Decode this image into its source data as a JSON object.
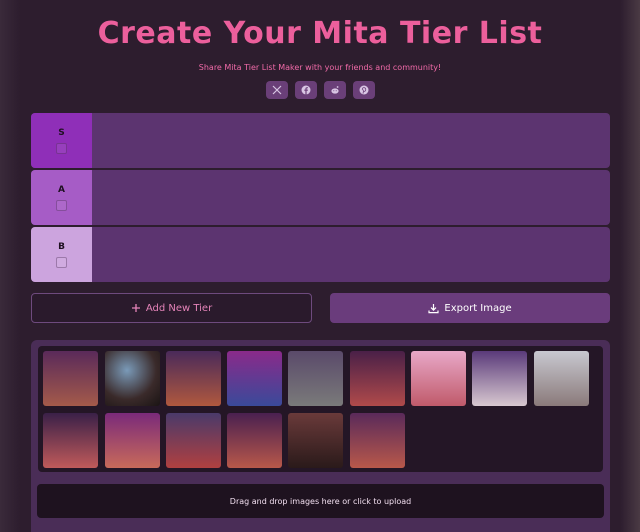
{
  "header": {
    "title": "Create Your Mita Tier List",
    "subtitle": "Share Mita Tier List Maker with your friends and community!"
  },
  "share": [
    {
      "name": "x-icon"
    },
    {
      "name": "facebook-icon"
    },
    {
      "name": "reddit-icon"
    },
    {
      "name": "pinterest-icon"
    }
  ],
  "tiers": [
    {
      "label": "S",
      "color": "#8f2fb8"
    },
    {
      "label": "A",
      "color": "#a65cc6"
    },
    {
      "label": "B",
      "color": "#cca4de"
    }
  ],
  "actions": {
    "add_label": "Add New Tier",
    "export_label": "Export Image"
  },
  "gallery": {
    "image_count": 15
  },
  "upload": {
    "label": "Drag and drop images here or click to upload"
  },
  "colors": {
    "accent": "#ec5f9c",
    "tier_row": "#5c3470",
    "button": "#6a3c7c"
  }
}
